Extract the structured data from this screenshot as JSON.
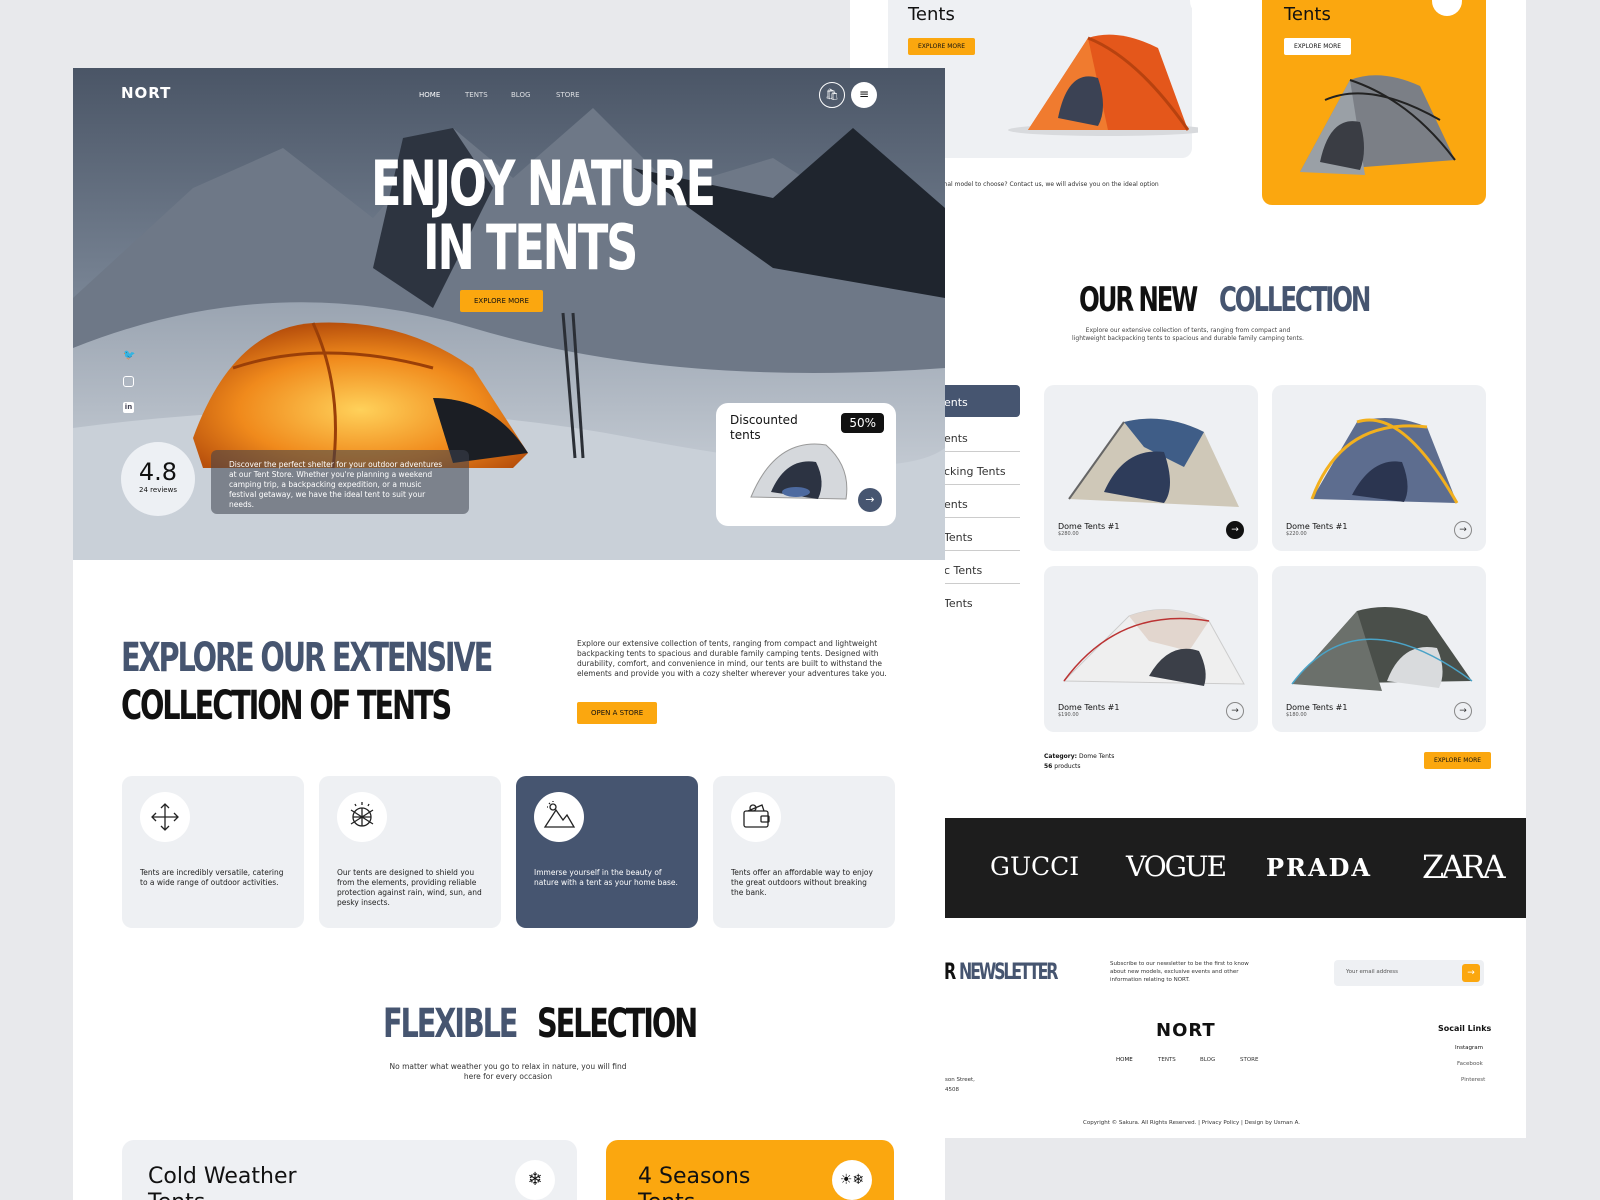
{
  "brand": {
    "logo": "NORT"
  },
  "colors": {
    "accent": "#fba70f",
    "navy": "#465570",
    "dark": "#1d1d1d",
    "light_card": "#eef0f3"
  },
  "hero": {
    "nav": [
      "HOME",
      "TENTS",
      "BLOG",
      "STORE"
    ],
    "title_line1": "ENJOY NATURE",
    "title_line2": "IN TENTS",
    "cta": "EXPLORE MORE",
    "rating": "4.8",
    "reviews": "24 reviews",
    "description": "Discover the perfect shelter for your outdoor adventures at our Tent Store. Whether you're planning a weekend camping trip, a backpacking expedition, or a music festival getaway, we have the ideal tent to suit your needs.",
    "promo_title": "Discounted tents",
    "promo_badge": "50%",
    "social_icons": [
      "twitter-icon",
      "instagram-icon",
      "linkedin-icon"
    ]
  },
  "explore": {
    "heading_line1": "EXPLORE OUR EXTENSIVE",
    "heading_line2": "COLLECTION OF TENTS",
    "text": "Explore our extensive collection of tents, ranging from compact and lightweight backpacking tents to spacious and durable family camping tents. Designed with durability, comfort, and convenience in mind, our tents are built to withstand the elements and provide you with a cozy shelter wherever your adventures take you.",
    "cta": "OPEN A STORE"
  },
  "features": [
    {
      "icon": "arrows-icon",
      "text": "Tents are incredibly versatile, catering to a wide range of outdoor activities."
    },
    {
      "icon": "globe-shield-icon",
      "text": "Our tents are designed to shield you from the elements, providing reliable protection against rain, wind, sun, and pesky insects."
    },
    {
      "icon": "mountain-sun-icon",
      "text": "Immerse yourself in the beauty of nature with a tent as your home base."
    },
    {
      "icon": "wallet-icon",
      "text": "Tents offer an affordable way to enjoy the great outdoors without breaking the bank."
    }
  ],
  "flexible": {
    "heading_a": "FLEXIBLE",
    "heading_b": "SELECTION",
    "text": "No matter what weather you go to relax in nature, you will find here for every occasion"
  },
  "bottom_cards": [
    {
      "title": "Cold Weather",
      "title2": "Tents",
      "icon": "snowflake-icon"
    },
    {
      "title": "4 Seasons",
      "title2": "Tents",
      "icon": "seasons-icon"
    }
  ],
  "back": {
    "top_card1_title": "Tents",
    "top_card2_title": "Tents",
    "explore_more": "EXPLORE MORE",
    "advice_text": "optimal model to choose? Contact us, we will advise you on the ideal option",
    "collection_a": "OUR NEW",
    "collection_b": "COLLECTION",
    "collection_text": "Explore our extensive collection of tents, ranging from compact and lightweight backpacking tents to spacious and durable family camping tents.",
    "categories": [
      "ents",
      "ents",
      "cking Tents",
      "ents",
      "Tents",
      "c Tents",
      "Tents"
    ],
    "products": [
      {
        "name": "Dome Tents #1",
        "price": "$280.00"
      },
      {
        "name": "Dome Tents #1",
        "price": "$220.00"
      },
      {
        "name": "Dome Tents #1",
        "price": "$190.00"
      },
      {
        "name": "Dome Tents #1",
        "price": "$180.00"
      }
    ],
    "category_label": "Category:",
    "category_value": "Dome Tents",
    "products_count": "56",
    "products_label": "products",
    "brands": [
      "GUCCI",
      "VOGUE",
      "PRADA",
      "ZARA"
    ],
    "newsletter_a": "R",
    "newsletter_b": "NEWSLETTER",
    "newsletter_text": "Subscribe to our newsletter to be the first to know about new models, exclusive events and other information relating to NORT.",
    "email_placeholder": "Your email address",
    "footer_logo": "NORT",
    "footer_nav": [
      "HOME",
      "TENTS",
      "BLOG",
      "STORE"
    ],
    "social_title": "Socail Links",
    "social_links": [
      "Instagram",
      "Facebook",
      "Pinterest"
    ],
    "address_frag": [
      "son Street,",
      "4508"
    ],
    "copyright": "Copyright © Sakura. All Rights Reserved. | Privacy Policy | Design by Usman A."
  }
}
